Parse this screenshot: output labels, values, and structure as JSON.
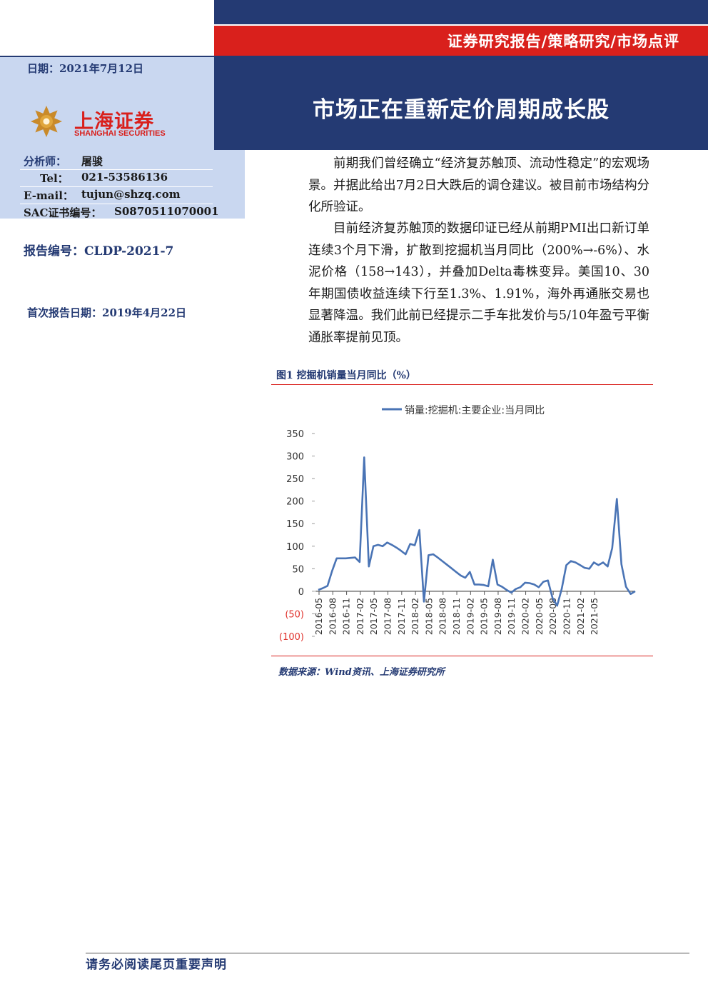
{
  "header": {
    "report_type": "证券研究报告/策略研究/市场点评",
    "title": "市场正在重新定价周期成长股",
    "date": "日期：2021年7月12日",
    "logo_cn": "上海证券",
    "logo_en": "SHANGHAI SECURITIES"
  },
  "analyst": {
    "rows": [
      {
        "label": "分析师：",
        "value": "屠骏"
      },
      {
        "label": "Tel：",
        "value": "021-53586136"
      },
      {
        "label": "E-mail：",
        "value": "tujun@shzq.com"
      },
      {
        "label": "SAC证书编号：",
        "value": "S0870511070001"
      }
    ]
  },
  "report_no": "报告编号：CLDP-2021-7",
  "first_report_date": "首次报告日期：2019年4月22日",
  "body": {
    "paragraphs": [
      "前期我们曾经确立“经济复苏触顶、流动性稳定”的宏观场景。并据此给出7月2日大跌后的调仓建议。被目前市场结构分化所验证。",
      "目前经济复苏触顶的数据印证已经从前期PMI出口新订单连续3个月下滑，扩散到挖掘机当月同比（200%→-6%）、水泥价格（158→143），并叠加Delta毒株变异。美国10、30年期国债收益连续下行至1.3%、1.91%，海外再通胀交易也显著降温。我们此前已经提示二手车批发价与5/10年盈亏平衡通胀率提前见顶。"
    ]
  },
  "figure": {
    "caption": "图1 挖掘机销量当月同比（%）",
    "source": "数据来源：Wind资讯、上海证券研究所"
  },
  "chart_data": {
    "type": "line",
    "legend": "销量:挖掘机:主要企业:当月同比",
    "legend_position": "top-center",
    "series_color": "#4a74b5",
    "negative_label_color": "#e0322c",
    "ylim": [
      -100,
      350
    ],
    "yticks": [
      350,
      300,
      250,
      200,
      150,
      100,
      50,
      0,
      -50,
      -100
    ],
    "ytick_labels": [
      "350",
      "300",
      "250",
      "200",
      "150",
      "100",
      "50",
      "0",
      "(50)",
      "(100)"
    ],
    "xtick_labels": [
      "2016-05",
      "2016-08",
      "2016-11",
      "2017-02",
      "2017-05",
      "2017-08",
      "2017-11",
      "2018-02",
      "2018-05",
      "2018-08",
      "2018-11",
      "2019-02",
      "2019-05",
      "2019-08",
      "2019-11",
      "2020-02",
      "2020-05",
      "2020-08",
      "2020-11",
      "2021-02",
      "2021-05"
    ],
    "grid": false,
    "values": [
      3,
      7,
      12,
      45,
      73,
      73,
      73,
      74,
      75,
      65,
      297,
      55,
      100,
      103,
      100,
      108,
      103,
      97,
      90,
      82,
      105,
      102,
      136,
      -23,
      80,
      82,
      75,
      67,
      59,
      51,
      43,
      35,
      30,
      43,
      15,
      15,
      14,
      11,
      70,
      15,
      10,
      3,
      -3,
      5,
      9,
      19,
      18,
      15,
      9,
      21,
      24,
      -15,
      -32,
      5,
      58,
      67,
      64,
      58,
      52,
      50,
      64,
      58,
      64,
      55,
      96,
      205,
      60,
      10,
      -6,
      0
    ]
  }
}
